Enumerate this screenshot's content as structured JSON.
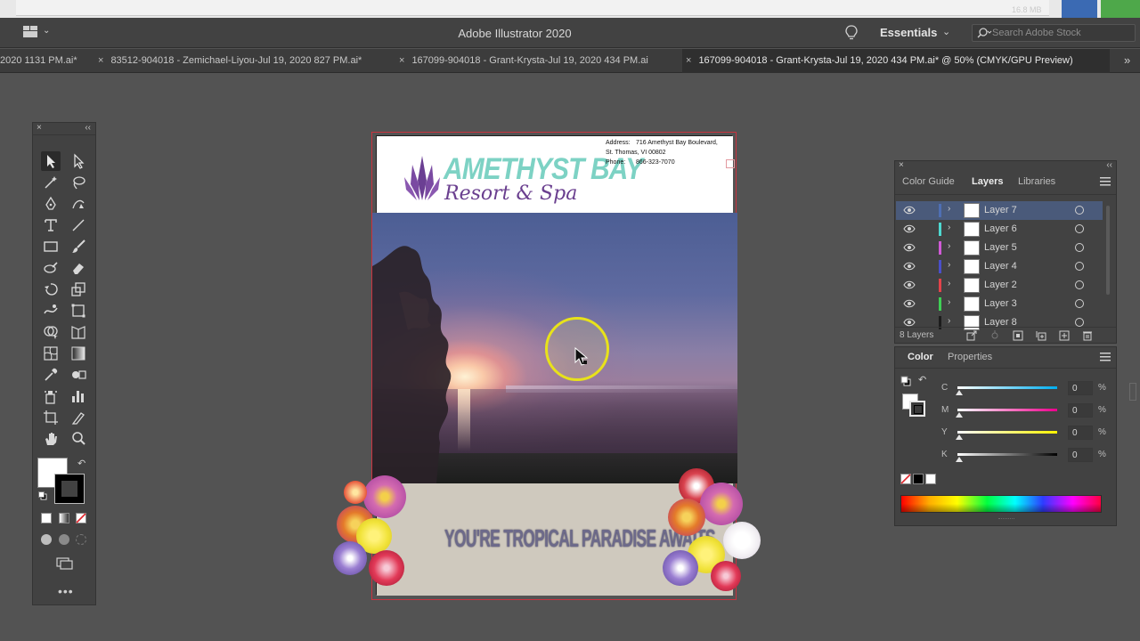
{
  "os_strip": {
    "ghost_text": "16.8 MB"
  },
  "appbar": {
    "title": "Adobe Illustrator 2020",
    "workspace": "Essentials",
    "search_placeholder": "Search Adobe Stock"
  },
  "tabs": [
    {
      "label": "2020 1131 PM.ai*",
      "close": "×",
      "active": false
    },
    {
      "label": "83512-904018 - Zemichael-Liyou-Jul 19, 2020 827 PM.ai*",
      "close": "×",
      "active": false
    },
    {
      "label": "167099-904018 - Grant-Krysta-Jul 19, 2020 434 PM.ai",
      "close": "×",
      "active": false
    },
    {
      "label": "167099-904018 - Grant-Krysta-Jul 19, 2020 434 PM.ai* @ 50% (CMYK/GPU Preview)",
      "close": "×",
      "active": true
    }
  ],
  "tabs_more": "»",
  "tools_panel": {
    "close": "×",
    "collapse": "‹‹",
    "more": "•••"
  },
  "artboard": {
    "brand_top": "AMETHYST BAY",
    "brand_bottom": "Resort & Spa",
    "address_line1_label": "Address:",
    "address_line1_value": "716 Amethyst Bay Boulevard,",
    "address_line2": "St. Thomas, VI 00802",
    "phone_label": "Phone:",
    "phone_value": "866-323-7070",
    "tagline": "YOU'RE TROPICAL PARADISE AWAITS"
  },
  "layers_panel": {
    "tabs": [
      "Color Guide",
      "Layers",
      "Libraries"
    ],
    "active_tab": "Layers",
    "layers": [
      {
        "name": "Layer 7",
        "color": "#4f6fb3",
        "selected": true
      },
      {
        "name": "Layer 6",
        "color": "#4ed8d0",
        "selected": false
      },
      {
        "name": "Layer 5",
        "color": "#d05ad6",
        "selected": false
      },
      {
        "name": "Layer 4",
        "color": "#4a4fc9",
        "selected": false
      },
      {
        "name": "Layer 2",
        "color": "#e2434a",
        "selected": false
      },
      {
        "name": "Layer 3",
        "color": "#3fcf55",
        "selected": false
      },
      {
        "name": "Layer 8",
        "color": "#1c1c1c",
        "selected": false
      }
    ],
    "count": "8 Layers"
  },
  "color_panel": {
    "tabs": [
      "Color",
      "Properties"
    ],
    "active_tab": "Color",
    "channels": [
      {
        "label": "C",
        "value": "0",
        "pct": "%",
        "gradient": "linear-gradient(90deg,#ffffff,#00aeef)"
      },
      {
        "label": "M",
        "value": "0",
        "pct": "%",
        "gradient": "linear-gradient(90deg,#ffffff,#ec008c)"
      },
      {
        "label": "Y",
        "value": "0",
        "pct": "%",
        "gradient": "linear-gradient(90deg,#ffffff,#fff200)"
      },
      {
        "label": "K",
        "value": "0",
        "pct": "%",
        "gradient": "linear-gradient(90deg,#ffffff,#000000)"
      }
    ]
  },
  "colors": {
    "accent_selection": "#4a5a7a",
    "bleed_line": "#c9333f",
    "cursor_ring": "#e8e21a",
    "brand_teal": "#7dd2c4",
    "brand_purple": "#6a3f8f"
  }
}
